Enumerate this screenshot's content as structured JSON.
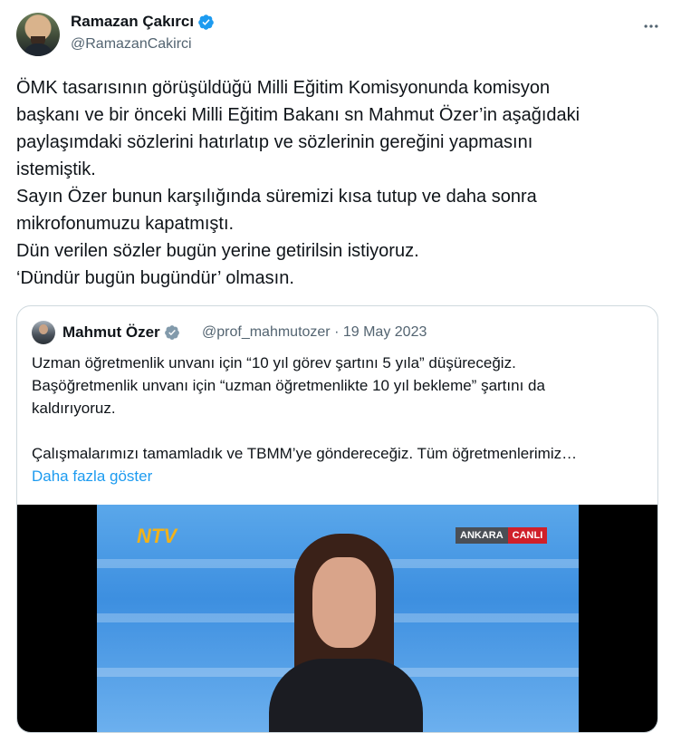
{
  "author": {
    "name": "Ramazan Çakırcı",
    "handle": "@RamazanCakirci",
    "verified_color": "#1d9bf0"
  },
  "more_icon": "ellipsis-icon",
  "tweet": {
    "lines": [
      "ÖMK tasarısının görüşüldüğü Milli Eğitim Komisyonunda komisyon",
      "başkanı ve bir önceki Milli Eğitim Bakanı sn Mahmut Özer’in aşağıdaki",
      "paylaşımdaki sözlerini hatırlatıp ve  sözlerinin gereğini yapmasını",
      "istemiştik.",
      "Sayın Özer bunun karşılığında süremizi kısa tutup ve daha sonra",
      "mikrofonumuzu kapatmıştı.",
      "Dün verilen sözler bugün yerine getirilsin istiyoruz.",
      "‘Dündür bugün bugündür’ olmasın."
    ]
  },
  "quote": {
    "name": "Mahmut Özer",
    "handle_date": "@prof_mahmutozer · 19 May 2023",
    "lines": [
      "Uzman öğretmenlik unvanı için “10 yıl görev şartını 5 yıla” düşüreceğiz.",
      "Başöğretmenlik unvanı için “uzman öğretmenlikte 10 yıl bekleme” şartını da",
      "kaldırıyoruz.",
      "Çalışmalarımızı tamamladık ve TBMM’ye göndereceğiz. Tüm öğretmenlerimiz…"
    ],
    "show_more": "Daha fazla göster",
    "media": {
      "channel_logo": "NTV",
      "location": "ANKARA",
      "live": "CANLI"
    }
  }
}
